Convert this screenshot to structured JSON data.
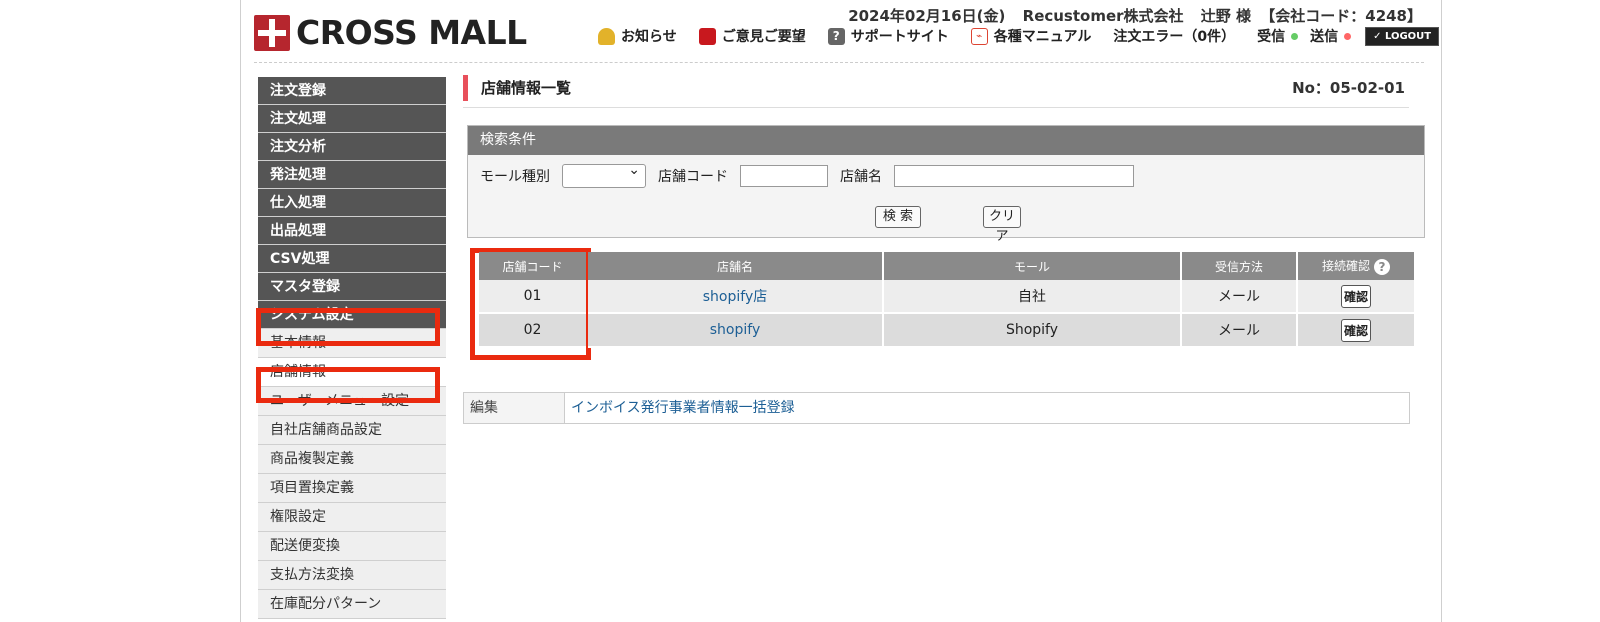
{
  "header": {
    "logo_text": "CROSS MALL",
    "date": "2024年02月16日(金)",
    "company": "Recustomer株式会社",
    "user": "辻野 様",
    "company_code": "【会社コード：4248】",
    "nav": {
      "notice": "お知らせ",
      "feedback": "ご意見ご要望",
      "support": "サポートサイト",
      "manual": "各種マニュアル",
      "order_error": "注文エラー（0件）",
      "receive": "受信",
      "send": "送信",
      "logout": "✓ LOGOUT"
    }
  },
  "sidebar": {
    "main_items": [
      {
        "label": "注文登録"
      },
      {
        "label": "注文処理"
      },
      {
        "label": "注文分析"
      },
      {
        "label": "発注処理"
      },
      {
        "label": "仕入処理"
      },
      {
        "label": "出品処理"
      },
      {
        "label": "CSV処理"
      },
      {
        "label": "マスタ登録"
      },
      {
        "label": "システム設定"
      }
    ],
    "sub_items": [
      {
        "label": "基本情報"
      },
      {
        "label": "店舗情報"
      },
      {
        "label": "ユーザーメニュー設定"
      },
      {
        "label": "自社店舗商品設定"
      },
      {
        "label": "商品複製定義"
      },
      {
        "label": "項目置換定義"
      },
      {
        "label": "権限設定"
      },
      {
        "label": "配送便変換"
      },
      {
        "label": "支払方法変換"
      },
      {
        "label": "在庫配分パターン"
      }
    ]
  },
  "main": {
    "title": "店舗情報一覧",
    "page_no": "No：05-02-01",
    "search": {
      "header": "検索条件",
      "mall_type_label": "モール種別",
      "mall_type_value": "",
      "store_code_label": "店舗コード",
      "store_code_value": "",
      "store_name_label": "店舗名",
      "store_name_value": "",
      "search_button": "検 索",
      "clear_button": "クリア"
    },
    "table": {
      "headers": [
        "店舗コード",
        "店舗名",
        "モール",
        "受信方法",
        "接続確認"
      ],
      "rows": [
        {
          "code": "01",
          "name": "shopify店",
          "mall": "自社",
          "method": "メール",
          "confirm": "確認"
        },
        {
          "code": "02",
          "name": "shopify",
          "mall": "Shopify",
          "method": "メール",
          "confirm": "確認"
        }
      ]
    },
    "edit": {
      "label": "編集",
      "link": "インボイス発行事業者情報一括登録"
    }
  },
  "colors": {
    "highlight": "#ea2a0f",
    "sidebar_dark": "#555555",
    "link": "#1d5f95",
    "title_accent": "#e8505b"
  }
}
